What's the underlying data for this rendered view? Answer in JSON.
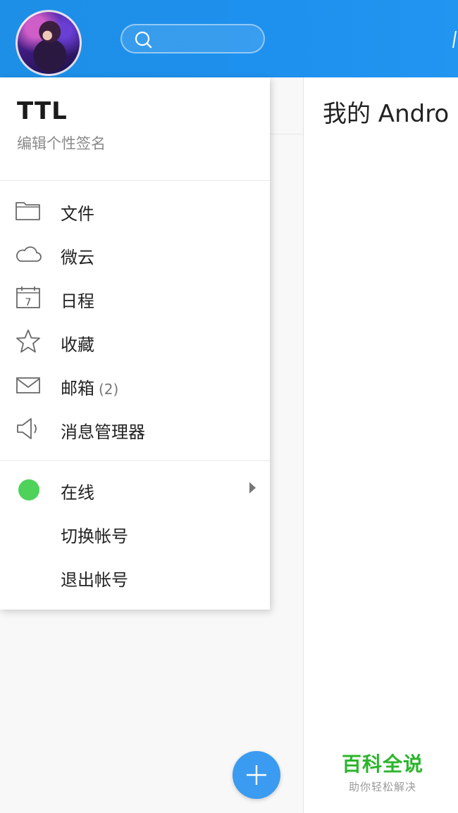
{
  "header": {
    "avatar_icon": "user-avatar",
    "search_icon": "search-icon"
  },
  "right_panel": {
    "title": "我的 Andro"
  },
  "profile": {
    "name": "TTL",
    "signature": "编辑个性签名"
  },
  "menu": {
    "items": [
      {
        "label": "文件",
        "icon": "folder-icon"
      },
      {
        "label": "微云",
        "icon": "cloud-icon"
      },
      {
        "label": "日程",
        "icon": "calendar-icon",
        "calendar_day": "7"
      },
      {
        "label": "收藏",
        "icon": "star-icon"
      },
      {
        "label": "邮箱",
        "icon": "mail-icon",
        "badge": "(2)"
      },
      {
        "label": "消息管理器",
        "icon": "speaker-icon"
      }
    ],
    "status": {
      "label": "在线",
      "color": "#4ed25a"
    },
    "switch_account": "切换帐号",
    "logout": "退出帐号"
  },
  "watermark": {
    "title": "百科全说",
    "subtitle": "助你轻松解决"
  },
  "colors": {
    "header": "#1e90ee",
    "fab": "#3a9bf0",
    "online": "#4ed25a",
    "watermark": "#2cb52c"
  }
}
